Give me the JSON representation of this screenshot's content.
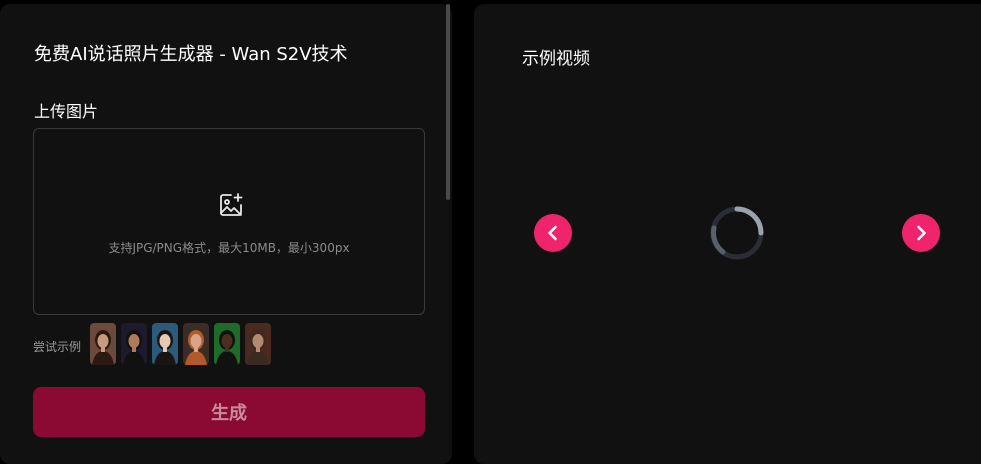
{
  "left_panel": {
    "title": "免费AI说话照片生成器 - Wan S2V技术",
    "upload_label": "上传图片",
    "upload_icon": "image-add-icon",
    "upload_hint": "支持JPG/PNG格式，最大10MB，最小300px",
    "try_examples_label": "尝试示例",
    "example_thumbnails": [
      {
        "name": "example-portrait-1",
        "bg": "#6b4a3c",
        "skin": "#c99a80",
        "hair": "#2a1a12"
      },
      {
        "name": "example-portrait-2",
        "bg": "#1d1a2e",
        "skin": "#b07a5e",
        "hair": "#111111"
      },
      {
        "name": "example-portrait-3",
        "bg": "#2b5a7a",
        "skin": "#e8c9b3",
        "hair": "#1a1412"
      },
      {
        "name": "example-portrait-4",
        "bg": "#3b2c26",
        "skin": "#d8a58a",
        "hair": "#b25a2a"
      },
      {
        "name": "example-portrait-5",
        "bg": "#1e6b2a",
        "skin": "#4a2e20",
        "hair": "#111111"
      },
      {
        "name": "example-portrait-6",
        "bg": "#4a2a1e",
        "skin": "#b48a6e",
        "hair": "#3a2a22"
      }
    ],
    "generate_label": "生成"
  },
  "right_panel": {
    "title": "示例视频",
    "prev_icon": "chevron-left-icon",
    "next_icon": "chevron-right-icon",
    "loading_icon": "loading-spinner-icon"
  },
  "colors": {
    "accent": "#f0246c",
    "generate_button": "#8b0a33",
    "panel_bg": "#111111"
  }
}
